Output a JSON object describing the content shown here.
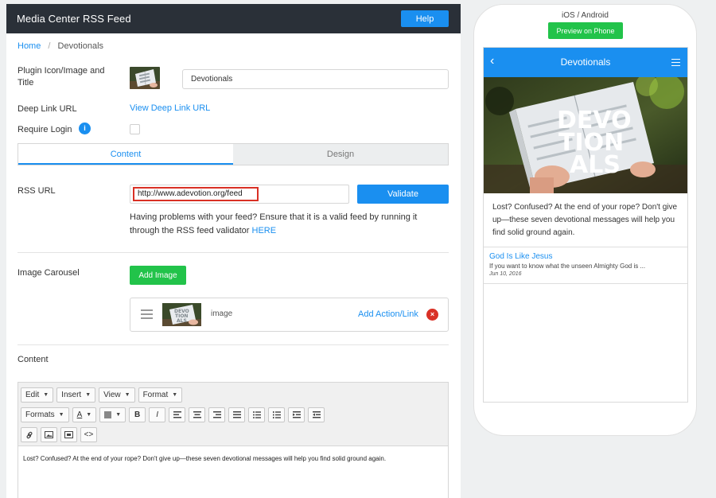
{
  "app": {
    "title": "Media Center RSS Feed",
    "help_label": "Help"
  },
  "breadcrumb": {
    "home": "Home",
    "separator": "/",
    "current": "Devotionals"
  },
  "form": {
    "plugin_icon_label": "Plugin Icon/Image and Title",
    "title_value": "Devotionals",
    "deep_link_label": "Deep Link URL",
    "deep_link_link": "View Deep Link URL",
    "require_login_label": "Require Login",
    "info_glyph": "i",
    "require_login_checked": false
  },
  "tabs": [
    {
      "label": "Content",
      "active": true
    },
    {
      "label": "Design",
      "active": false
    }
  ],
  "rss": {
    "label": "RSS URL",
    "value": "http://www.adevotion.org/feed",
    "validate_label": "Validate",
    "help_text": "Having problems with your feed? Ensure that it is a valid feed by running it through the RSS feed validator",
    "help_link": "HERE"
  },
  "carousel": {
    "label": "Image Carousel",
    "add_image_label": "Add Image",
    "items": [
      {
        "label": "image",
        "action_label": "Add Action/Link",
        "remove_glyph": "×"
      }
    ]
  },
  "content": {
    "label": "Content",
    "toolbar_menus": [
      "Edit",
      "Insert",
      "View",
      "Format"
    ],
    "formats_label": "Formats",
    "text_color_glyph": "A",
    "bold_glyph": "B",
    "italic_glyph": "I",
    "code_glyph": "<>",
    "body": "Lost? Confused? At the end of your rope? Don't give up—these seven devotional messages will help you find solid ground again."
  },
  "preview": {
    "os_label": "iOS / Android",
    "preview_button": "Preview on Phone",
    "screen_title": "Devotionals",
    "back_glyph": "‹",
    "hero_text": [
      "DEVO",
      "TION",
      "ALS"
    ],
    "intro": "Lost? Confused? At the end of your rope? Don't give up—these seven devotional messages will help you find solid ground again.",
    "items": [
      {
        "title": "God Is Like Jesus",
        "desc": "If you want to know what the unseen Almighty God is ...",
        "date": "Jun 10, 2016"
      }
    ]
  },
  "colors": {
    "accent": "#1a8ff0",
    "success": "#22c34a",
    "danger": "#d93025",
    "topbar": "#2a3038"
  }
}
